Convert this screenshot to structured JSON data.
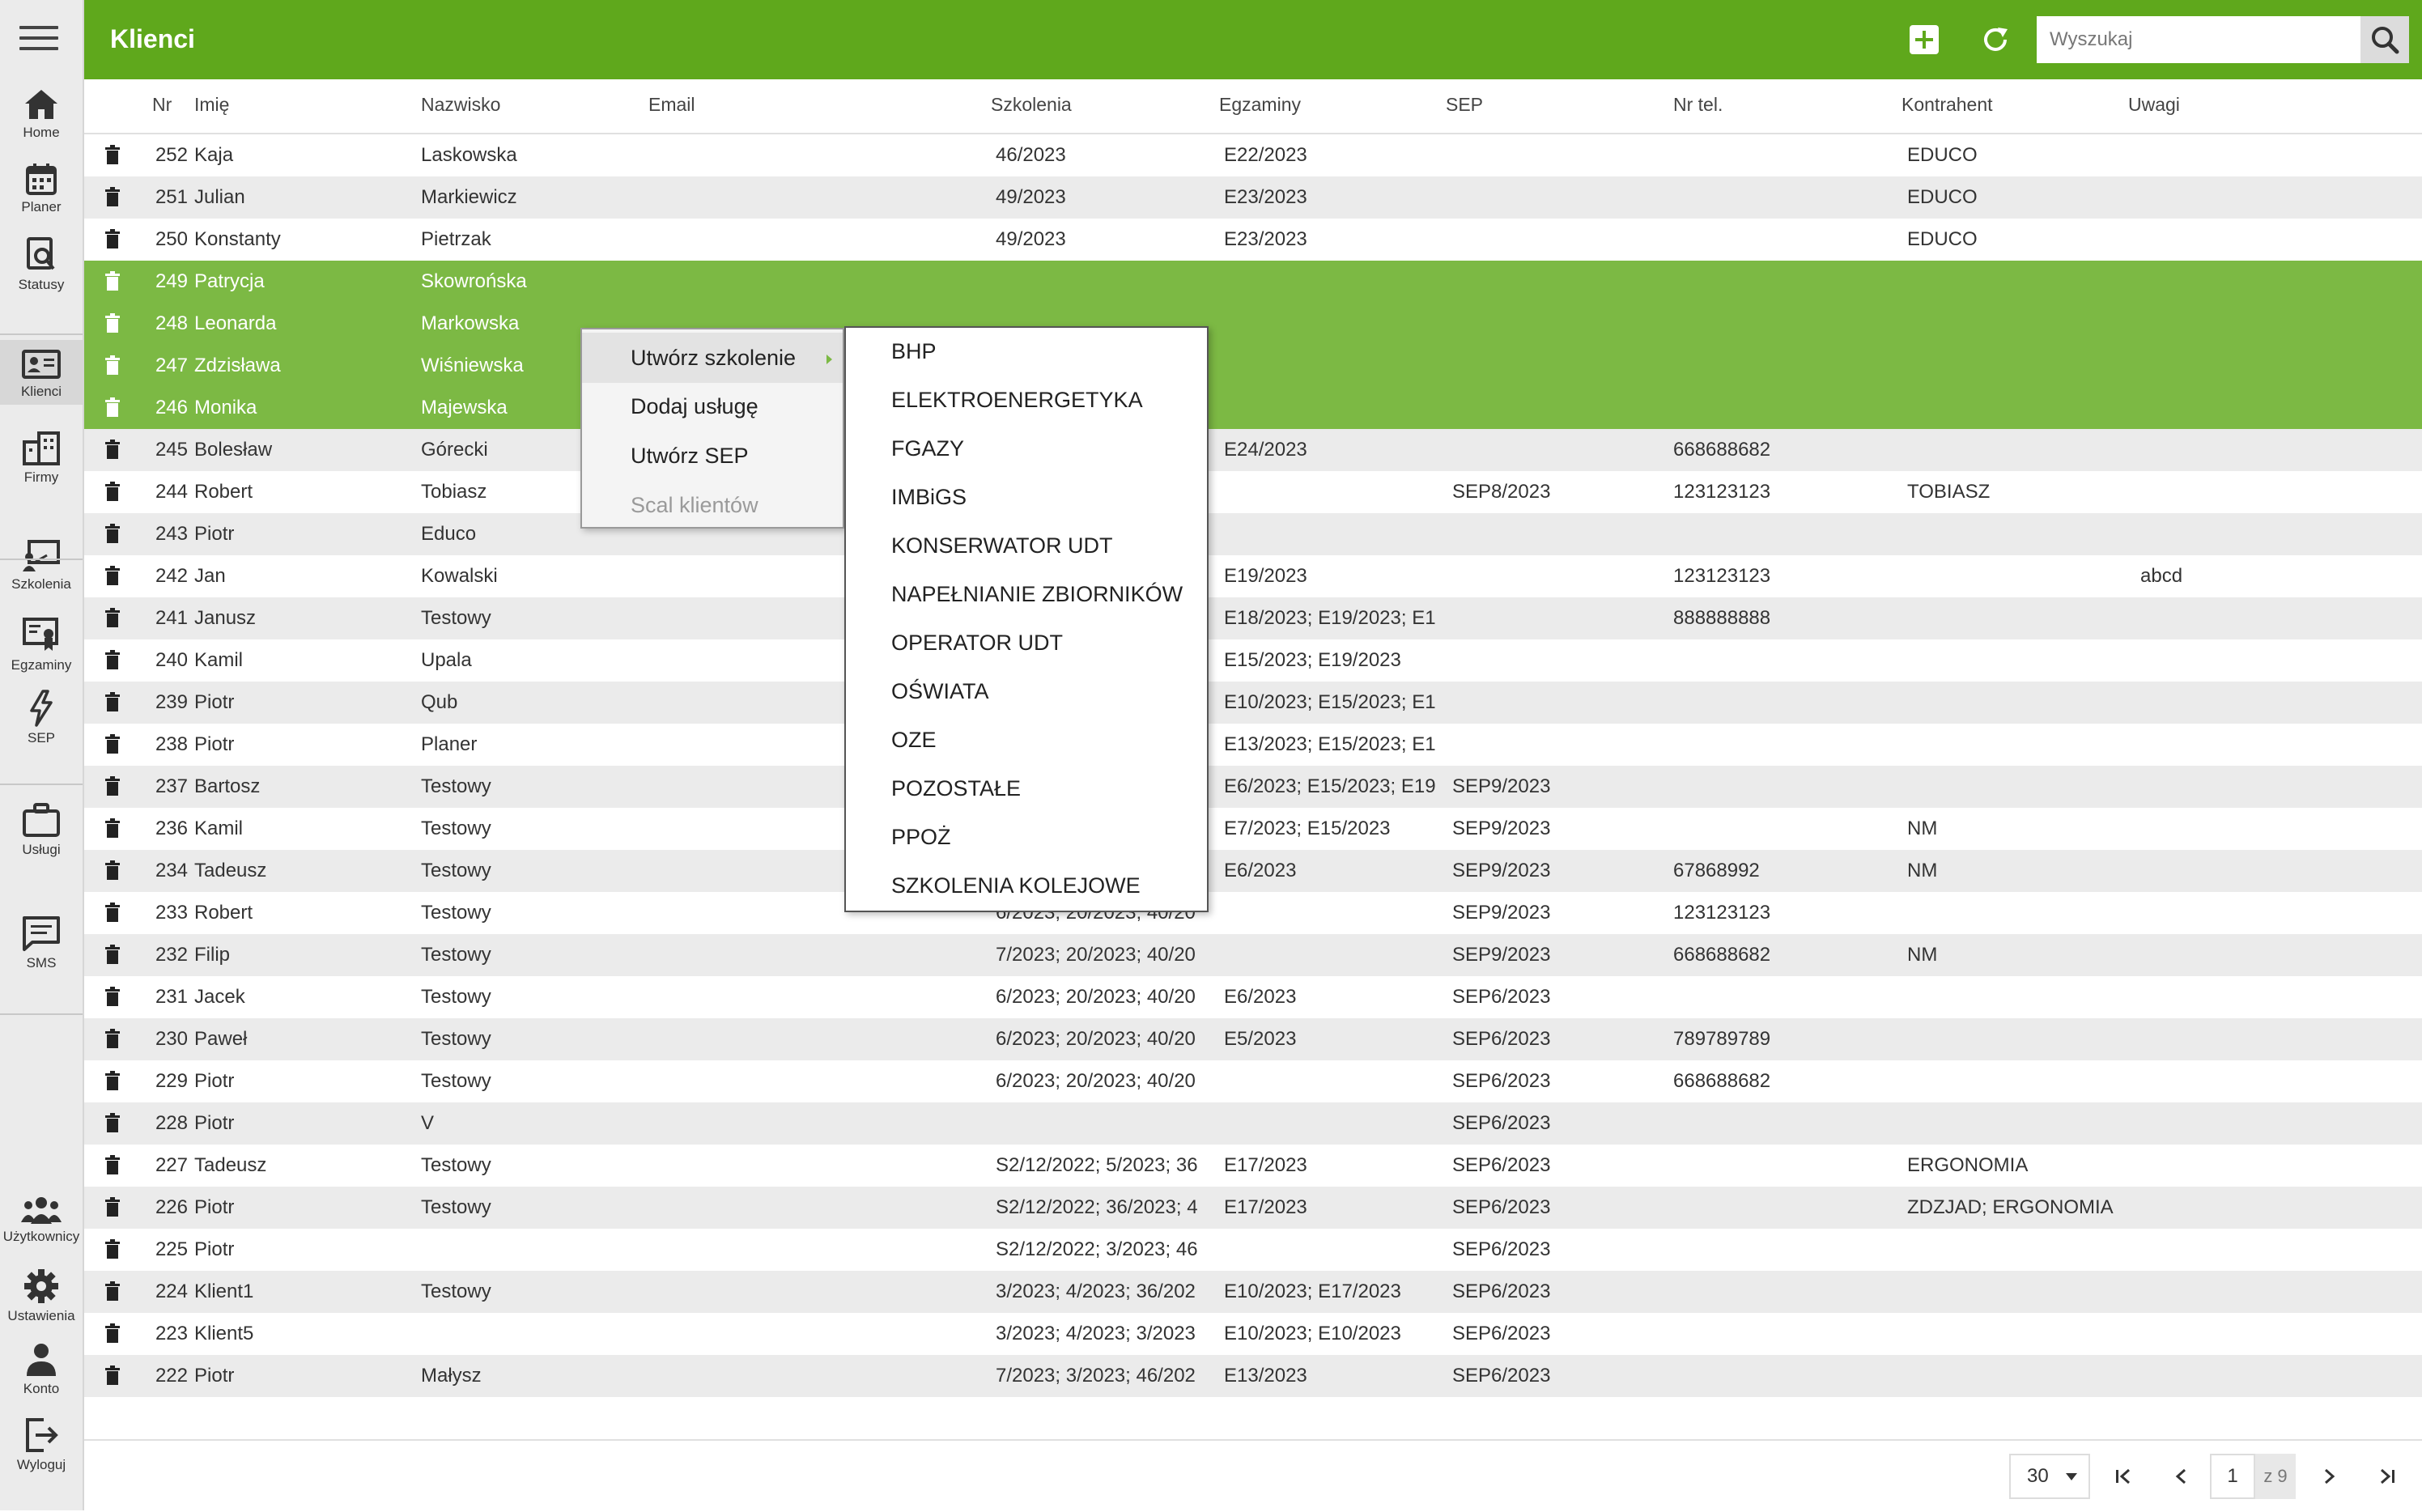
{
  "app": {
    "title": "Klienci",
    "accent_color": "#5fa81c",
    "selected_row_color": "#7cb944"
  },
  "sidebar": {
    "items": [
      {
        "label": "Home",
        "icon": "home-icon"
      },
      {
        "label": "Planer",
        "icon": "calendar-icon"
      },
      {
        "label": "Statusy",
        "icon": "status-search-icon"
      },
      {
        "label": "Klienci",
        "icon": "id-card-icon"
      },
      {
        "label": "Firmy",
        "icon": "building-icon"
      },
      {
        "label": "Szkolenia",
        "icon": "presentation-icon"
      },
      {
        "label": "Egzaminy",
        "icon": "certificate-icon"
      },
      {
        "label": "SEP",
        "icon": "lightning-icon"
      },
      {
        "label": "Usługi",
        "icon": "briefcase-icon"
      },
      {
        "label": "SMS",
        "icon": "message-icon"
      },
      {
        "label": "Użytkownicy",
        "icon": "users-icon"
      },
      {
        "label": "Ustawienia",
        "icon": "gear-icon"
      },
      {
        "label": "Konto",
        "icon": "user-icon"
      },
      {
        "label": "Wyloguj",
        "icon": "logout-icon"
      }
    ]
  },
  "header": {
    "search_placeholder": "Wyszukaj",
    "add_icon": "plus-icon",
    "refresh_icon": "refresh-icon",
    "search_icon": "search-icon"
  },
  "table": {
    "columns": [
      "Nr",
      "Imię",
      "Nazwisko",
      "Email",
      "Szkolenia",
      "Egzaminy",
      "SEP",
      "Nr tel.",
      "Kontrahent",
      "Uwagi"
    ],
    "rows": [
      {
        "nr": "252",
        "imie": "Kaja",
        "nazwisko": "Laskowska",
        "email": "",
        "szkolenia": "46/2023",
        "egzaminy": "E22/2023",
        "sep": "",
        "tel": "",
        "kontrahent": "EDUCO",
        "uwagi": "",
        "selected": false
      },
      {
        "nr": "251",
        "imie": "Julian",
        "nazwisko": "Markiewicz",
        "email": "",
        "szkolenia": "49/2023",
        "egzaminy": "E23/2023",
        "sep": "",
        "tel": "",
        "kontrahent": "EDUCO",
        "uwagi": "",
        "selected": false
      },
      {
        "nr": "250",
        "imie": "Konstanty",
        "nazwisko": "Pietrzak",
        "email": "",
        "szkolenia": "49/2023",
        "egzaminy": "E23/2023",
        "sep": "",
        "tel": "",
        "kontrahent": "EDUCO",
        "uwagi": "",
        "selected": false
      },
      {
        "nr": "249",
        "imie": "Patrycja",
        "nazwisko": "Skowrońska",
        "email": "",
        "szkolenia": "",
        "egzaminy": "",
        "sep": "",
        "tel": "",
        "kontrahent": "",
        "uwagi": "",
        "selected": true
      },
      {
        "nr": "248",
        "imie": "Leonarda",
        "nazwisko": "Markowska",
        "email": "",
        "szkolenia": "",
        "egzaminy": "",
        "sep": "",
        "tel": "",
        "kontrahent": "",
        "uwagi": "",
        "selected": true
      },
      {
        "nr": "247",
        "imie": "Zdzisława",
        "nazwisko": "Wiśniewska",
        "email": "",
        "szkolenia": "",
        "egzaminy": "",
        "sep": "",
        "tel": "",
        "kontrahent": "",
        "uwagi": "",
        "selected": true
      },
      {
        "nr": "246",
        "imie": "Monika",
        "nazwisko": "Majewska",
        "email": "",
        "szkolenia": "",
        "egzaminy": "",
        "sep": "",
        "tel": "",
        "kontrahent": "",
        "uwagi": "",
        "selected": true
      },
      {
        "nr": "245",
        "imie": "Bolesław",
        "nazwisko": "Górecki",
        "email": "",
        "szkolenia": "",
        "egzaminy": "E24/2023",
        "sep": "",
        "tel": "668688682",
        "kontrahent": "",
        "uwagi": "",
        "selected": false
      },
      {
        "nr": "244",
        "imie": "Robert",
        "nazwisko": "Tobiasz",
        "email": "",
        "szkolenia": "",
        "egzaminy": "",
        "sep": "SEP8/2023",
        "tel": "123123123",
        "kontrahent": "TOBIASZ",
        "uwagi": "",
        "selected": false
      },
      {
        "nr": "243",
        "imie": "Piotr",
        "nazwisko": "Educo",
        "email": "",
        "szkolenia": "",
        "egzaminy": "",
        "sep": "",
        "tel": "",
        "kontrahent": "",
        "uwagi": "",
        "selected": false
      },
      {
        "nr": "242",
        "imie": "Jan",
        "nazwisko": "Kowalski",
        "email": "",
        "szkolenia": "",
        "egzaminy": "E19/2023",
        "sep": "",
        "tel": "123123123",
        "kontrahent": "",
        "uwagi": "abcd",
        "selected": false
      },
      {
        "nr": "241",
        "imie": "Janusz",
        "nazwisko": "Testowy",
        "email": "",
        "szkolenia": "",
        "egzaminy": "E18/2023; E19/2023; E1",
        "sep": "",
        "tel": "888888888",
        "kontrahent": "",
        "uwagi": "",
        "selected": false
      },
      {
        "nr": "240",
        "imie": "Kamil",
        "nazwisko": "Upala",
        "email": "",
        "szkolenia": "",
        "egzaminy": "E15/2023; E19/2023",
        "sep": "",
        "tel": "",
        "kontrahent": "",
        "uwagi": "",
        "selected": false
      },
      {
        "nr": "239",
        "imie": "Piotr",
        "nazwisko": "Qub",
        "email": "",
        "szkolenia": "",
        "egzaminy": "E10/2023; E15/2023; E1",
        "sep": "",
        "tel": "",
        "kontrahent": "",
        "uwagi": "",
        "selected": false
      },
      {
        "nr": "238",
        "imie": "Piotr",
        "nazwisko": "Planer",
        "email": "",
        "szkolenia": "",
        "egzaminy": "E13/2023; E15/2023; E1",
        "sep": "",
        "tel": "",
        "kontrahent": "",
        "uwagi": "",
        "selected": false
      },
      {
        "nr": "237",
        "imie": "Bartosz",
        "nazwisko": "Testowy",
        "email": "",
        "szkolenia": "",
        "egzaminy": "E6/2023; E15/2023; E19",
        "sep": "SEP9/2023",
        "tel": "",
        "kontrahent": "",
        "uwagi": "",
        "selected": false
      },
      {
        "nr": "236",
        "imie": "Kamil",
        "nazwisko": "Testowy",
        "email": "",
        "szkolenia": "",
        "egzaminy": "E7/2023; E15/2023",
        "sep": "SEP9/2023",
        "tel": "",
        "kontrahent": "NM",
        "uwagi": "",
        "selected": false
      },
      {
        "nr": "234",
        "imie": "Tadeusz",
        "nazwisko": "Testowy",
        "email": "",
        "szkolenia": "",
        "egzaminy": "E6/2023",
        "sep": "SEP9/2023",
        "tel": "67868992",
        "kontrahent": "NM",
        "uwagi": "",
        "selected": false
      },
      {
        "nr": "233",
        "imie": "Robert",
        "nazwisko": "Testowy",
        "email": "",
        "szkolenia": "6/2023; 20/2023; 40/20",
        "egzaminy": "",
        "sep": "SEP9/2023",
        "tel": "123123123",
        "kontrahent": "",
        "uwagi": "",
        "selected": false
      },
      {
        "nr": "232",
        "imie": "Filip",
        "nazwisko": "Testowy",
        "email": "",
        "szkolenia": "7/2023; 20/2023; 40/20",
        "egzaminy": "",
        "sep": "SEP9/2023",
        "tel": "668688682",
        "kontrahent": "NM",
        "uwagi": "",
        "selected": false
      },
      {
        "nr": "231",
        "imie": "Jacek",
        "nazwisko": "Testowy",
        "email": "",
        "szkolenia": "6/2023; 20/2023; 40/20",
        "egzaminy": "E6/2023",
        "sep": "SEP6/2023",
        "tel": "",
        "kontrahent": "",
        "uwagi": "",
        "selected": false
      },
      {
        "nr": "230",
        "imie": "Paweł",
        "nazwisko": "Testowy",
        "email": "",
        "szkolenia": "6/2023; 20/2023; 40/20",
        "egzaminy": "E5/2023",
        "sep": "SEP6/2023",
        "tel": "789789789",
        "kontrahent": "",
        "uwagi": "",
        "selected": false
      },
      {
        "nr": "229",
        "imie": "Piotr",
        "nazwisko": "Testowy",
        "email": "",
        "szkolenia": "6/2023; 20/2023; 40/20",
        "egzaminy": "",
        "sep": "SEP6/2023",
        "tel": "668688682",
        "kontrahent": "",
        "uwagi": "",
        "selected": false
      },
      {
        "nr": "228",
        "imie": "Piotr",
        "nazwisko": "V",
        "email": "",
        "szkolenia": "",
        "egzaminy": "",
        "sep": "SEP6/2023",
        "tel": "",
        "kontrahent": "",
        "uwagi": "",
        "selected": false
      },
      {
        "nr": "227",
        "imie": "Tadeusz",
        "nazwisko": "Testowy",
        "email": "",
        "szkolenia": "S2/12/2022; 5/2023; 36",
        "egzaminy": "E17/2023",
        "sep": "SEP6/2023",
        "tel": "",
        "kontrahent": "ERGONOMIA",
        "uwagi": "",
        "selected": false
      },
      {
        "nr": "226",
        "imie": "Piotr",
        "nazwisko": "Testowy",
        "email": "",
        "szkolenia": "S2/12/2022; 36/2023; 4",
        "egzaminy": "E17/2023",
        "sep": "SEP6/2023",
        "tel": "",
        "kontrahent": "ZDZJAD; ERGONOMIA",
        "uwagi": "",
        "selected": false
      },
      {
        "nr": "225",
        "imie": "Piotr",
        "nazwisko": "",
        "email": "",
        "szkolenia": "S2/12/2022; 3/2023; 46",
        "egzaminy": "",
        "sep": "SEP6/2023",
        "tel": "",
        "kontrahent": "",
        "uwagi": "",
        "selected": false
      },
      {
        "nr": "224",
        "imie": "Klient1",
        "nazwisko": "Testowy",
        "email": "",
        "szkolenia": "3/2023; 4/2023; 36/202",
        "egzaminy": "E10/2023; E17/2023",
        "sep": "SEP6/2023",
        "tel": "",
        "kontrahent": "",
        "uwagi": "",
        "selected": false
      },
      {
        "nr": "223",
        "imie": "Klient5",
        "nazwisko": "",
        "email": "",
        "szkolenia": "3/2023; 4/2023; 3/2023",
        "egzaminy": "E10/2023; E10/2023",
        "sep": "SEP6/2023",
        "tel": "",
        "kontrahent": "",
        "uwagi": "",
        "selected": false
      },
      {
        "nr": "222",
        "imie": "Piotr",
        "nazwisko": "Małysz",
        "email": "",
        "szkolenia": "7/2023; 3/2023; 46/202",
        "egzaminy": "E13/2023",
        "sep": "SEP6/2023",
        "tel": "",
        "kontrahent": "",
        "uwagi": "",
        "selected": false
      }
    ]
  },
  "context_menu": {
    "items": [
      {
        "label": "Utwórz szkolenie",
        "has_submenu": true,
        "disabled": false
      },
      {
        "label": "Dodaj usługę",
        "has_submenu": false,
        "disabled": false
      },
      {
        "label": "Utwórz SEP",
        "has_submenu": false,
        "disabled": false
      },
      {
        "label": "Scal klientów",
        "has_submenu": false,
        "disabled": true
      }
    ],
    "submenu": [
      "BHP",
      "ELEKTROENERGETYKA",
      "FGAZY",
      "IMBiGS",
      "KONSERWATOR UDT",
      "NAPEŁNIANIE ZBIORNIKÓW",
      "OPERATOR UDT",
      "OŚWIATA",
      "OZE",
      "POZOSTAŁE",
      "PPOŻ",
      "SZKOLENIA KOLEJOWE"
    ]
  },
  "pagination": {
    "page_size": "30",
    "current_page": "1",
    "total_label": "z 9"
  }
}
